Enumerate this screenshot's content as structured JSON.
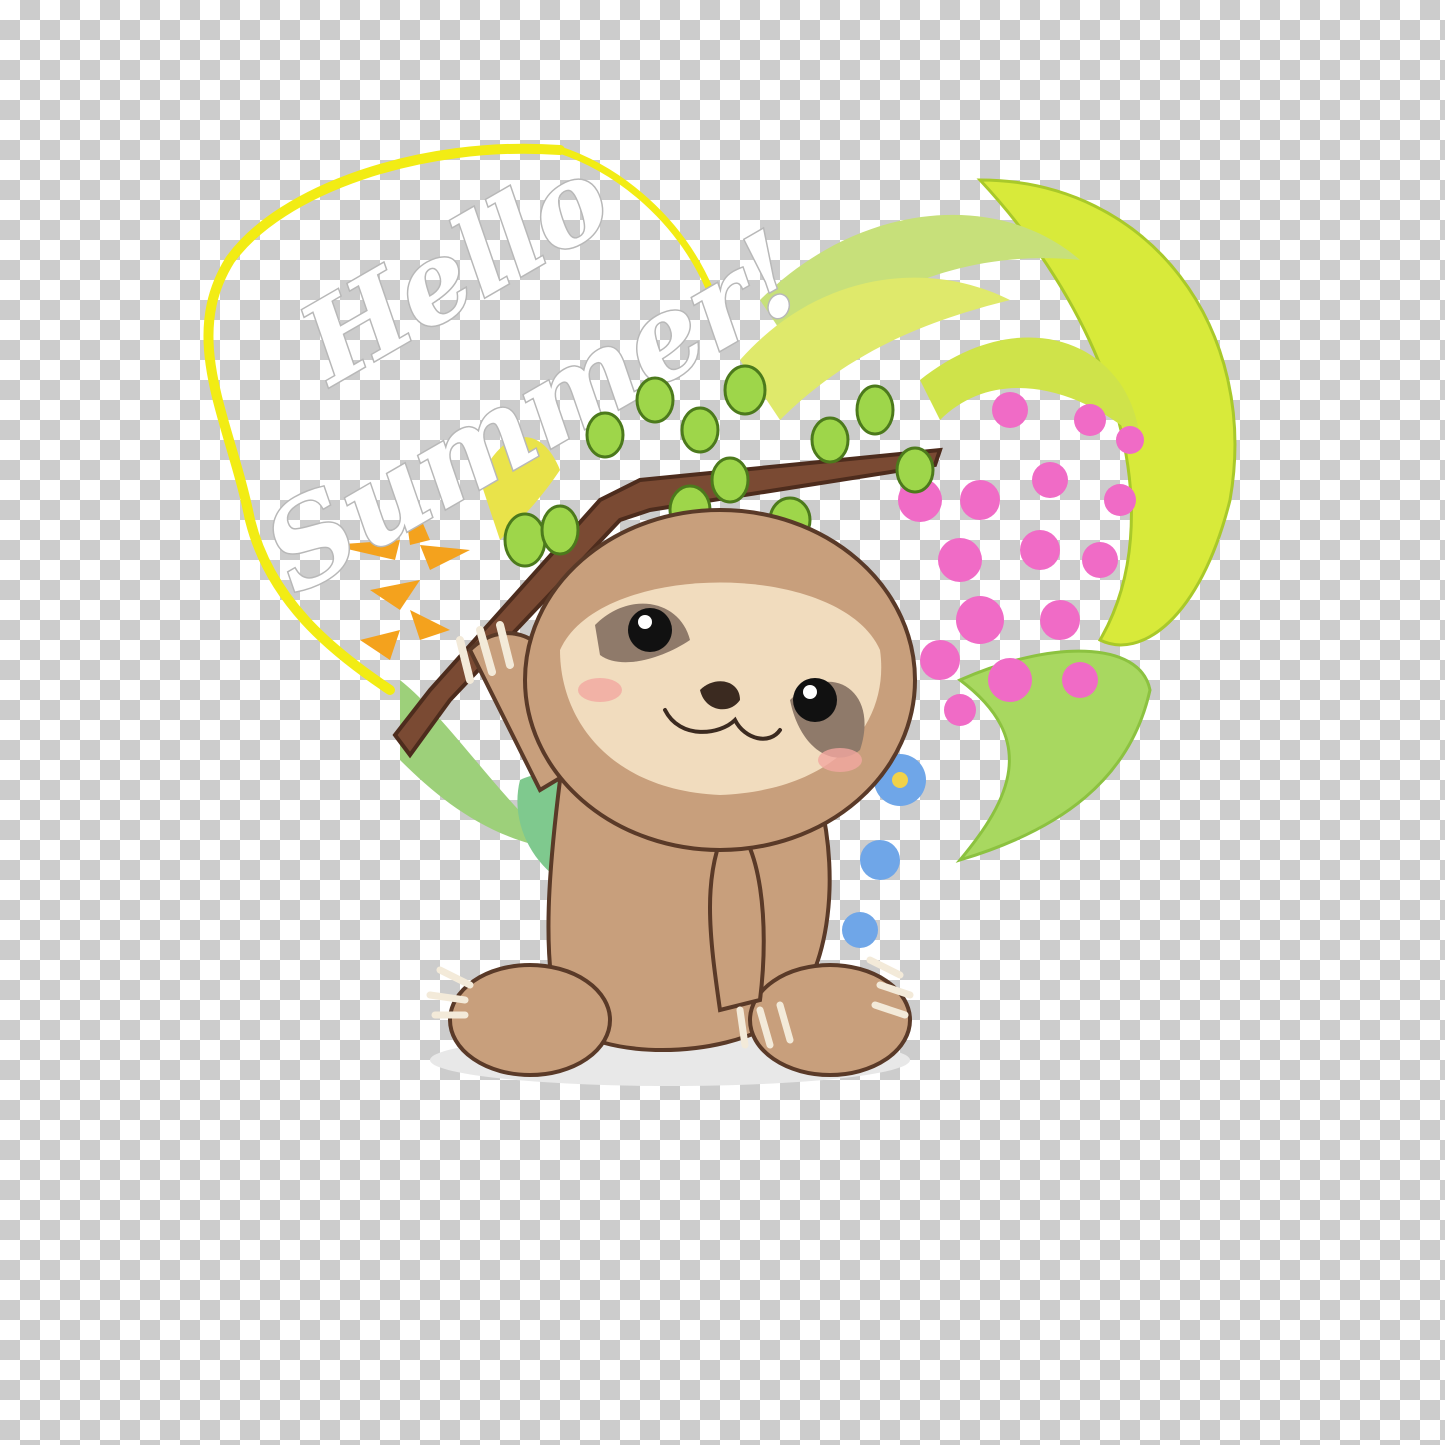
{
  "artwork": {
    "text_line1": "Hello",
    "text_line2": "Summer!",
    "subject": "sloth-holding-branch",
    "background": "transparency-checkerboard"
  },
  "colors": {
    "checker_light": "#ffffff",
    "checker_dark": "#cccccc",
    "heart_yellow": "#f2ec14",
    "leaf_green": "#9ed64a",
    "leaf_yellow": "#d8ea3a",
    "orchid_pink": "#f06bc6",
    "sloth_fur": "#c89f7c",
    "sloth_face": "#f1dcbe",
    "branch_brown": "#7a4a33",
    "heliconia_orange": "#f4a21d",
    "blue_flower": "#6fa6e8"
  }
}
